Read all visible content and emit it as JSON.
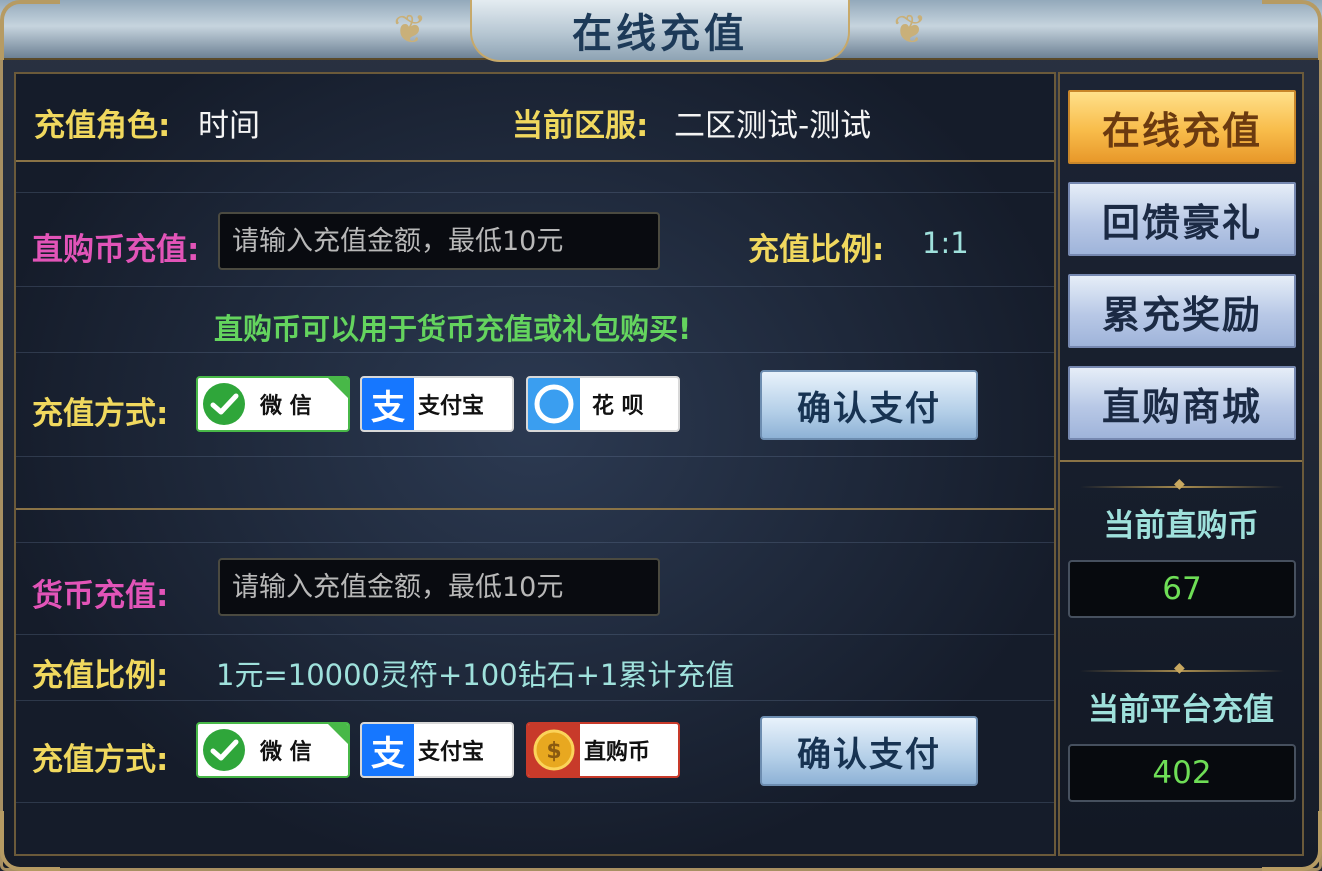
{
  "title": "在线充值",
  "role": {
    "label": "充值角色:",
    "value": "时间"
  },
  "server": {
    "label": "当前区服:",
    "value": "二区测试-测试"
  },
  "section1": {
    "label": "直购币充值:",
    "input_placeholder": "请输入充值金额，最低10元",
    "ratio_label": "充值比例:",
    "ratio_value": "1:1",
    "notice": "直购币可以用于货币充值或礼包购买!",
    "method_label": "充值方式:",
    "methods": [
      {
        "label": "微 信",
        "icon": "wechat-check-icon",
        "selected": true
      },
      {
        "label": "支付宝",
        "icon": "alipay-icon",
        "selected": false
      },
      {
        "label": "花 呗",
        "icon": "huabei-icon",
        "selected": false
      }
    ],
    "confirm": "确认支付"
  },
  "section2": {
    "label": "货币充值:",
    "input_placeholder": "请输入充值金额，最低10元",
    "ratio_label": "充值比例:",
    "ratio_value": "1元=10000灵符+100钻石+1累计充值",
    "method_label": "充值方式:",
    "methods": [
      {
        "label": "微 信",
        "icon": "wechat-check-icon",
        "selected": true
      },
      {
        "label": "支付宝",
        "icon": "alipay-icon",
        "selected": false
      },
      {
        "label": "直购币",
        "icon": "coin-icon",
        "selected": false
      }
    ],
    "confirm": "确认支付"
  },
  "sidebar": {
    "tabs": [
      {
        "label": "在线充值",
        "active": true
      },
      {
        "label": "回馈豪礼",
        "active": false
      },
      {
        "label": "累充奖励",
        "active": false
      },
      {
        "label": "直购商城",
        "active": false
      }
    ],
    "current_coin_label": "当前直购币",
    "current_coin_value": "67",
    "platform_recharge_label": "当前平台充值",
    "platform_recharge_value": "402"
  },
  "colors": {
    "gold_label": "#f0d85e",
    "pink_label": "#e254b8",
    "notice_green": "#64d45e",
    "value_cyan": "#9fe1dc",
    "active_tab": "#f8bc4a",
    "wechat": "#2fa63a",
    "alipay": "#1677ff",
    "coin": "#e8a820"
  }
}
